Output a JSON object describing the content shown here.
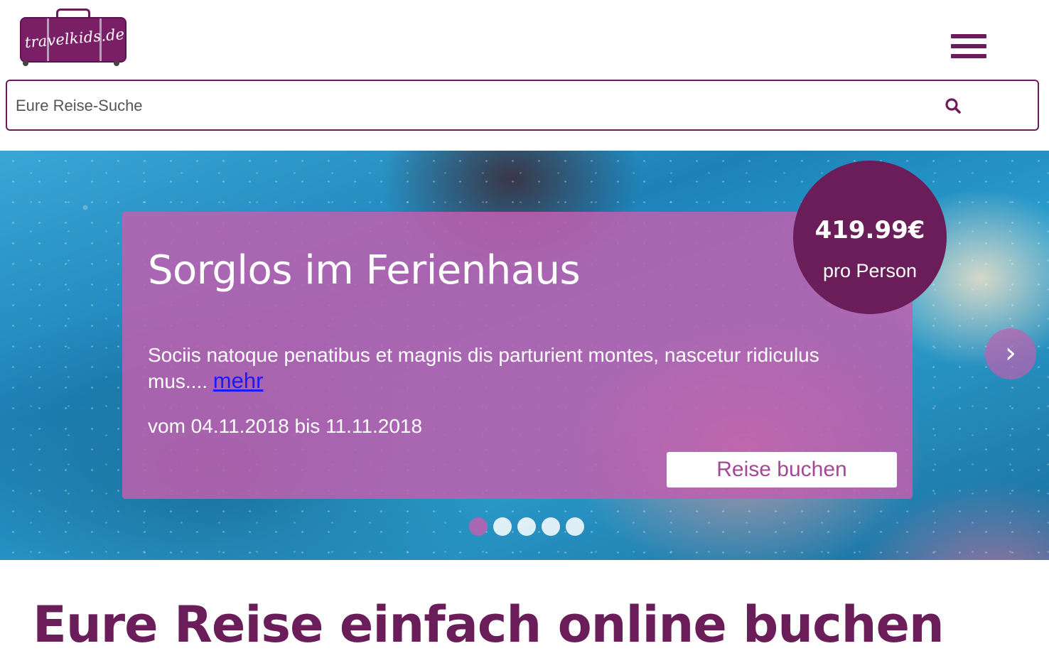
{
  "header": {
    "logo_text": "travelkids.de",
    "menu_icon": "hamburger-icon"
  },
  "search": {
    "placeholder": "Eure Reise-Suche",
    "value": "",
    "icon": "search-icon"
  },
  "hero": {
    "title": "Sorglos im Ferienhaus",
    "description": "Sociis natoque penatibus et magnis dis parturient montes, nascetur ridiculus mus....",
    "more_link": "mehr",
    "date_range": "vom 04.11.2018 bis 11.11.2018",
    "book_button": "Reise buchen",
    "price": "419.99€",
    "price_unit": "pro Person",
    "next_arrow": "›",
    "slide_count": 5,
    "active_slide": 1
  },
  "section": {
    "heading": "Eure Reise einfach online buchen"
  },
  "colors": {
    "brand": "#6b1d5a",
    "card": "#bf5faf",
    "link": "#1a1aff"
  }
}
